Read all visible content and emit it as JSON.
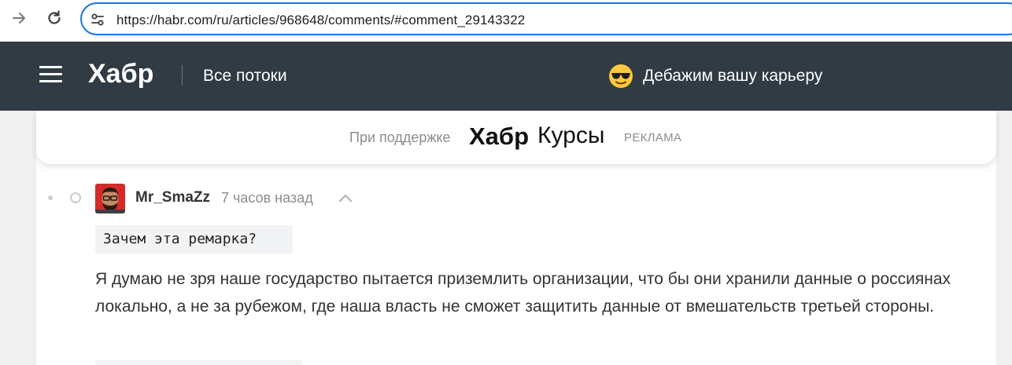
{
  "browser": {
    "url": "https://habr.com/ru/articles/968648/comments/#comment_29143322"
  },
  "header": {
    "logo": "Хабр",
    "all_streams": "Все потоки",
    "promo_text": "Дебажим вашу карьеру",
    "promo_emoji": "sunglasses-emoji"
  },
  "sponsor": {
    "label": "При поддержке",
    "brand_bold": "Хабр",
    "brand_light": "Курсы",
    "ad_label": "РЕКЛАМА"
  },
  "comment": {
    "username": "Mr_SmaZz",
    "time": "7 часов назад",
    "quote": "Зачем эта ремарка?",
    "text": "Я думаю не зря наше государство пытается приземлить организации, что бы они хранили данные о россиянах локально, а не за рубежом, где наша власть не сможет защитить данные от вмешательств третьей стороны."
  },
  "colors": {
    "header_bg": "#303b44",
    "url_focus": "#1a73e8",
    "page_bg": "#f0f0f0",
    "code_bg": "#f2f3f5"
  }
}
